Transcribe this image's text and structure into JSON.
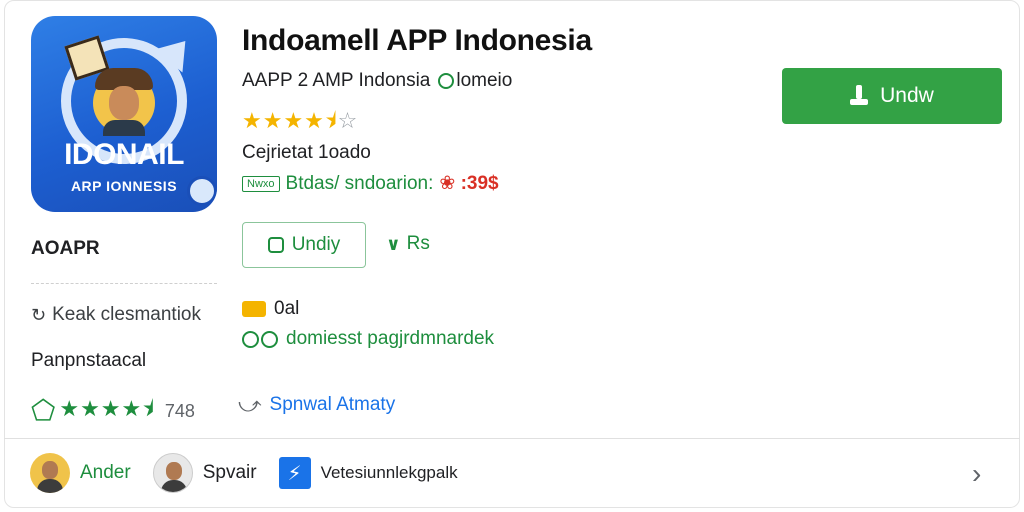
{
  "app": {
    "title": "Indoamell APP Indonesia",
    "developer": "AAPP 2 AMP Indonsia",
    "developer_suffix": "lomeio",
    "rating_stars": "★★★★",
    "rating_half": "⯨",
    "rating_empty": "☆",
    "category": "Cejrietat 1oado",
    "tag_badge": "Nwxo",
    "tag_text": "Btdas/ sndoarion:",
    "price": "❀ :39$",
    "icon_title": "IDONAIL",
    "icon_sub": "ARP IONNESIS"
  },
  "install_button": {
    "label": "Undw"
  },
  "secondary_button": {
    "label": "Undiy"
  },
  "more_link": {
    "label": "Rs"
  },
  "info": {
    "row1": "0al",
    "row2": "domiesst pagjrdmnardek"
  },
  "share": {
    "label": "Spnwal Atmaty"
  },
  "left": {
    "label1": "AOAPR",
    "row1": "Keak clesmantiok",
    "label2": "Panpnstaacal",
    "stars": "★★★★⯨",
    "count": "748"
  },
  "bottom": {
    "contributors": [
      {
        "name": "Ander"
      },
      {
        "name": "Spvair"
      },
      {
        "name": "Vetesiunnlekgpalk"
      }
    ]
  },
  "colors": {
    "accent_green": "#33a245",
    "star_yellow": "#f4b400",
    "link_blue": "#1a73e8",
    "icon_blue": "#2f7fe6"
  }
}
